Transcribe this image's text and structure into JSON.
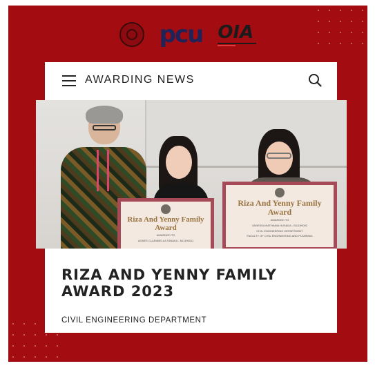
{
  "logos": {
    "seal_icon": "university-seal",
    "pcu": {
      "mark": "pcu",
      "subtitle": ""
    },
    "oia": {
      "mark": "OIA"
    }
  },
  "header": {
    "menu_icon": "hamburger-menu-icon",
    "title": "AWARDING NEWS",
    "search_icon": "search-icon"
  },
  "photo": {
    "certificates": [
      {
        "title": "Riza And Yenny Family Award",
        "recipient": "AWARDED TO",
        "name": "AGNES CLARABELLA TANAKA - B11190011"
      },
      {
        "title": "Riza And Yenny Family Award",
        "recipient": "AWARDED TO",
        "name": "VANESSA NATHANIA HUSADA - B11190002",
        "line2": "CIVIL ENGINEERING DEPARTMENT",
        "line3": "FACULTY OF CIVIL ENGINEERING AND PLANNING"
      }
    ]
  },
  "article": {
    "title": "RIZA AND YENNY FAMILY AWARD 2023",
    "department": "CIVIL ENGINEERING DEPARTMENT"
  },
  "colors": {
    "background": "#a30d12",
    "card": "#ffffff",
    "text": "#222222"
  }
}
